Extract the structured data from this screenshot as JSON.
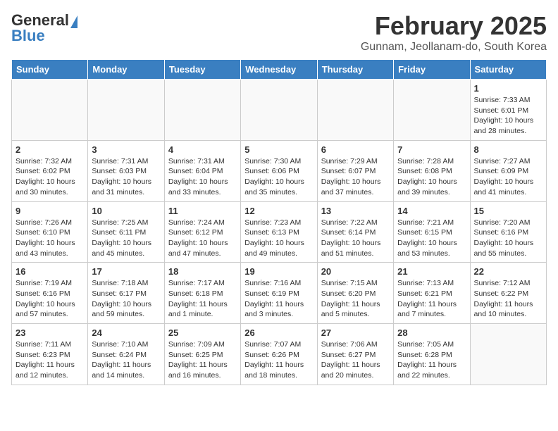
{
  "header": {
    "logo_general": "General",
    "logo_blue": "Blue",
    "month": "February 2025",
    "location": "Gunnam, Jeollanam-do, South Korea"
  },
  "weekdays": [
    "Sunday",
    "Monday",
    "Tuesday",
    "Wednesday",
    "Thursday",
    "Friday",
    "Saturday"
  ],
  "weeks": [
    [
      {
        "day": "",
        "info": ""
      },
      {
        "day": "",
        "info": ""
      },
      {
        "day": "",
        "info": ""
      },
      {
        "day": "",
        "info": ""
      },
      {
        "day": "",
        "info": ""
      },
      {
        "day": "",
        "info": ""
      },
      {
        "day": "1",
        "info": "Sunrise: 7:33 AM\nSunset: 6:01 PM\nDaylight: 10 hours\nand 28 minutes."
      }
    ],
    [
      {
        "day": "2",
        "info": "Sunrise: 7:32 AM\nSunset: 6:02 PM\nDaylight: 10 hours\nand 30 minutes."
      },
      {
        "day": "3",
        "info": "Sunrise: 7:31 AM\nSunset: 6:03 PM\nDaylight: 10 hours\nand 31 minutes."
      },
      {
        "day": "4",
        "info": "Sunrise: 7:31 AM\nSunset: 6:04 PM\nDaylight: 10 hours\nand 33 minutes."
      },
      {
        "day": "5",
        "info": "Sunrise: 7:30 AM\nSunset: 6:06 PM\nDaylight: 10 hours\nand 35 minutes."
      },
      {
        "day": "6",
        "info": "Sunrise: 7:29 AM\nSunset: 6:07 PM\nDaylight: 10 hours\nand 37 minutes."
      },
      {
        "day": "7",
        "info": "Sunrise: 7:28 AM\nSunset: 6:08 PM\nDaylight: 10 hours\nand 39 minutes."
      },
      {
        "day": "8",
        "info": "Sunrise: 7:27 AM\nSunset: 6:09 PM\nDaylight: 10 hours\nand 41 minutes."
      }
    ],
    [
      {
        "day": "9",
        "info": "Sunrise: 7:26 AM\nSunset: 6:10 PM\nDaylight: 10 hours\nand 43 minutes."
      },
      {
        "day": "10",
        "info": "Sunrise: 7:25 AM\nSunset: 6:11 PM\nDaylight: 10 hours\nand 45 minutes."
      },
      {
        "day": "11",
        "info": "Sunrise: 7:24 AM\nSunset: 6:12 PM\nDaylight: 10 hours\nand 47 minutes."
      },
      {
        "day": "12",
        "info": "Sunrise: 7:23 AM\nSunset: 6:13 PM\nDaylight: 10 hours\nand 49 minutes."
      },
      {
        "day": "13",
        "info": "Sunrise: 7:22 AM\nSunset: 6:14 PM\nDaylight: 10 hours\nand 51 minutes."
      },
      {
        "day": "14",
        "info": "Sunrise: 7:21 AM\nSunset: 6:15 PM\nDaylight: 10 hours\nand 53 minutes."
      },
      {
        "day": "15",
        "info": "Sunrise: 7:20 AM\nSunset: 6:16 PM\nDaylight: 10 hours\nand 55 minutes."
      }
    ],
    [
      {
        "day": "16",
        "info": "Sunrise: 7:19 AM\nSunset: 6:16 PM\nDaylight: 10 hours\nand 57 minutes."
      },
      {
        "day": "17",
        "info": "Sunrise: 7:18 AM\nSunset: 6:17 PM\nDaylight: 10 hours\nand 59 minutes."
      },
      {
        "day": "18",
        "info": "Sunrise: 7:17 AM\nSunset: 6:18 PM\nDaylight: 11 hours\nand 1 minute."
      },
      {
        "day": "19",
        "info": "Sunrise: 7:16 AM\nSunset: 6:19 PM\nDaylight: 11 hours\nand 3 minutes."
      },
      {
        "day": "20",
        "info": "Sunrise: 7:15 AM\nSunset: 6:20 PM\nDaylight: 11 hours\nand 5 minutes."
      },
      {
        "day": "21",
        "info": "Sunrise: 7:13 AM\nSunset: 6:21 PM\nDaylight: 11 hours\nand 7 minutes."
      },
      {
        "day": "22",
        "info": "Sunrise: 7:12 AM\nSunset: 6:22 PM\nDaylight: 11 hours\nand 10 minutes."
      }
    ],
    [
      {
        "day": "23",
        "info": "Sunrise: 7:11 AM\nSunset: 6:23 PM\nDaylight: 11 hours\nand 12 minutes."
      },
      {
        "day": "24",
        "info": "Sunrise: 7:10 AM\nSunset: 6:24 PM\nDaylight: 11 hours\nand 14 minutes."
      },
      {
        "day": "25",
        "info": "Sunrise: 7:09 AM\nSunset: 6:25 PM\nDaylight: 11 hours\nand 16 minutes."
      },
      {
        "day": "26",
        "info": "Sunrise: 7:07 AM\nSunset: 6:26 PM\nDaylight: 11 hours\nand 18 minutes."
      },
      {
        "day": "27",
        "info": "Sunrise: 7:06 AM\nSunset: 6:27 PM\nDaylight: 11 hours\nand 20 minutes."
      },
      {
        "day": "28",
        "info": "Sunrise: 7:05 AM\nSunset: 6:28 PM\nDaylight: 11 hours\nand 22 minutes."
      },
      {
        "day": "",
        "info": ""
      }
    ]
  ]
}
